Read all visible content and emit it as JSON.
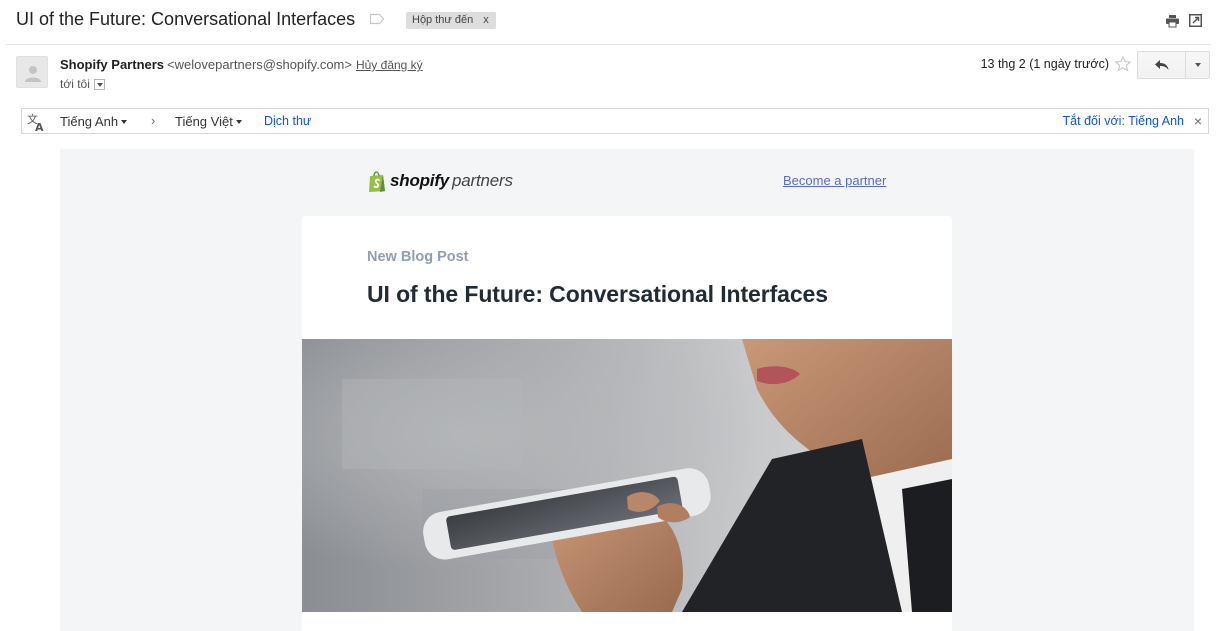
{
  "subject": {
    "title": "UI of the Future: Conversational Interfaces",
    "label_chip": "Hộp thư đến",
    "label_chip_close": "x"
  },
  "sender": {
    "name": "Shopify Partners",
    "email": "<welovepartners@shopify.com>",
    "unsubscribe": "Hủy đăng ký",
    "to": "tới tôi",
    "date": "13 thg 2 (1 ngày trước)"
  },
  "translate": {
    "from_lang": "Tiếng Anh",
    "arrow": "›",
    "to_lang": "Tiếng Việt",
    "translate_action": "Dịch thư",
    "turn_off": "Tắt đối với: Tiếng Anh",
    "close": "×"
  },
  "email": {
    "logo_bold": "shopify",
    "logo_light": "partners",
    "become_partner": "Become a partner",
    "kicker": "New Blog Post",
    "headline": "UI of the Future: Conversational Interfaces"
  },
  "icons": {
    "label": "label-icon",
    "print": "print-icon",
    "new_window": "new-window-icon",
    "avatar": "avatar-icon",
    "star": "star-icon",
    "reply": "reply-icon",
    "more": "chevron-down-icon",
    "translate": "translate-icon",
    "shopify_bag": "shopify-bag-icon"
  },
  "colors": {
    "link_blue": "#1155cc",
    "partner_link": "#5c6ac4",
    "kicker_gray": "#919eab",
    "headline_dark": "#212b36",
    "shopify_green": "#95bf47",
    "email_background": "#f4f5f7"
  }
}
